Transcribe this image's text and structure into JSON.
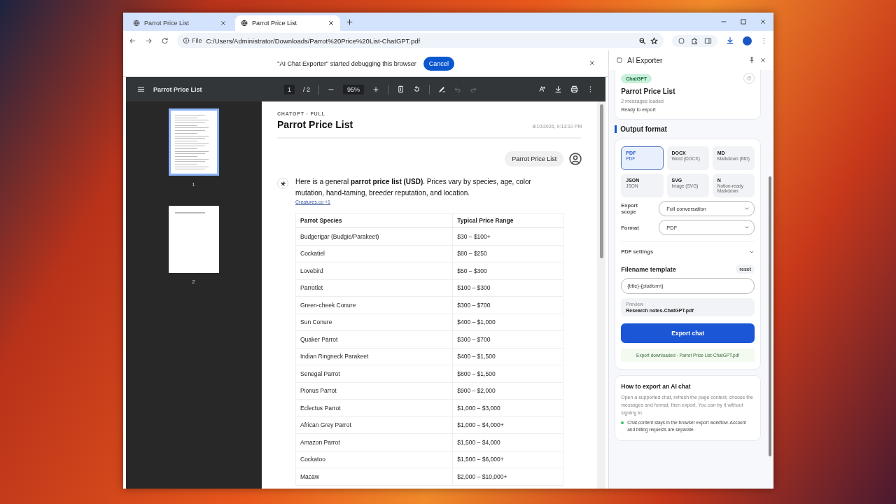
{
  "tabs": [
    {
      "title": "Parrot Price List",
      "selected": false
    },
    {
      "title": "Parrot Price List",
      "selected": true
    }
  ],
  "address_bar": {
    "scheme_label": "File",
    "url": "C:/Users/Administrator/Downloads/Parrot%20Price%20List-ChatGPT.pdf"
  },
  "infobar": {
    "message": "\"AI Chat Exporter\" started debugging this browser",
    "button": "Cancel"
  },
  "pdf_toolbar": {
    "title": "Parrot Price List",
    "page": "1",
    "page_total": "/ 2",
    "zoom": "95%"
  },
  "thumbnails": [
    {
      "label": "1",
      "selected": true
    },
    {
      "label": "2",
      "selected": false
    }
  ],
  "document": {
    "kicker": "CHATGPT · FULL",
    "title": "Parrot Price List",
    "timestamp": "8/10/2026, 9:13:10 PM",
    "user_message": "Parrot Price List",
    "intro": "Here is a general **parrot price list (USD)**. Prices vary by species, age, color mutation, hand-taming, breeder reputation, and location.",
    "source": "Creatures.co",
    "source_extra": "+1",
    "table": {
      "columns": [
        "Parrot Species",
        "Typical Price Range"
      ],
      "rows": [
        [
          "Budgerigar (Budgie/Parakeet)",
          "$30 – $100+"
        ],
        [
          "Cockatiel",
          "$80 – $250"
        ],
        [
          "Lovebird",
          "$50 – $300"
        ],
        [
          "Parrotlet",
          "$100 – $300"
        ],
        [
          "Green-cheek Conure",
          "$300 – $700"
        ],
        [
          "Sun Conure",
          "$400 – $1,000"
        ],
        [
          "Quaker Parrot",
          "$300 – $700"
        ],
        [
          "Indian Ringneck Parakeet",
          "$400 – $1,500"
        ],
        [
          "Senegal Parrot",
          "$800 – $1,500"
        ],
        [
          "Pionus Parrot",
          "$900 – $2,000"
        ],
        [
          "Eclectus Parrot",
          "$1,000 – $3,000"
        ],
        [
          "African Grey Parrot",
          "$1,000 – $4,000+"
        ],
        [
          "Amazon Parrot",
          "$1,500 – $4,000"
        ],
        [
          "Cockatoo",
          "$1,500 – $6,000+"
        ],
        [
          "Macaw",
          "$2,000 – $10,000+"
        ]
      ]
    }
  },
  "side_panel": {
    "title": "AI Exporter",
    "platform": "ChatGPT",
    "chat_title": "Parrot Price List",
    "messages_loaded": "2 messages loaded",
    "status": "Ready to export",
    "output_format_heading": "Output format",
    "formats": [
      {
        "code": "PDF",
        "label": "PDF",
        "selected": true
      },
      {
        "code": "DOCX",
        "label": "Word (DOCX)",
        "selected": false
      },
      {
        "code": "MD",
        "label": "Markdown (MD)",
        "selected": false
      },
      {
        "code": "JSON",
        "label": "JSON",
        "selected": false
      },
      {
        "code": "SVG",
        "label": "Image (SVG)",
        "selected": false
      },
      {
        "code": "N",
        "label": "Notion-ready Markdown",
        "selected": false
      }
    ],
    "selects": [
      {
        "label": "Export scope",
        "value": "Full conversation"
      },
      {
        "label": "Format",
        "value": "PDF"
      }
    ],
    "pdf_settings": {
      "label": "PDF settings",
      "expanded": false
    },
    "filename_template": {
      "label": "Filename template",
      "reset": "reset",
      "value": "{title}-{platform}"
    },
    "preview": {
      "label": "Preview",
      "value": "Research notes-ChatGPT.pdf"
    },
    "export_button": "Export chat",
    "export_message": "Export downloaded · Parrot Price List-ChatGPT.pdf",
    "help": {
      "title": "How to export an AI chat",
      "text": "Open a supported chat, refresh the page context, choose the messages and format, then export. You can try it without signing in.",
      "bullet": "Chat content stays in the browser export workflow. Account and billing requests are separate."
    }
  }
}
